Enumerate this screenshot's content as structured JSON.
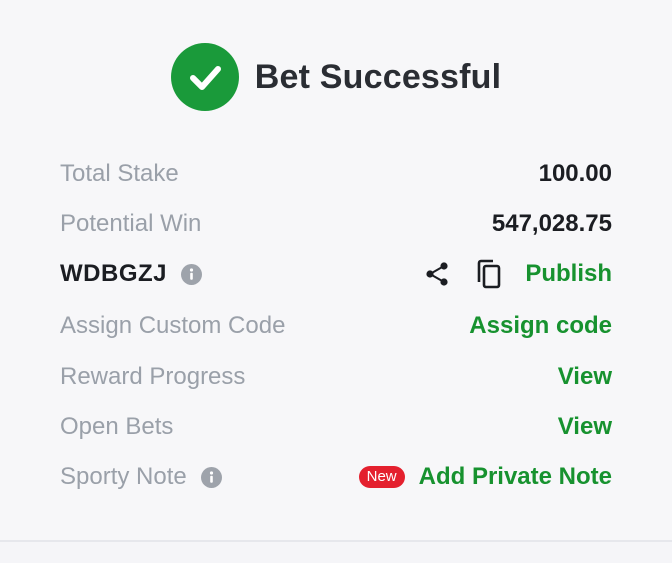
{
  "header": {
    "title": "Bet Successful"
  },
  "rows": {
    "total_stake": {
      "label": "Total Stake",
      "value": "100.00"
    },
    "potential_win": {
      "label": "Potential Win",
      "value": "547,028.75"
    },
    "booking": {
      "code": "WDBGZJ",
      "publish_label": "Publish"
    },
    "custom_code": {
      "label": "Assign Custom Code",
      "action": "Assign code"
    },
    "reward_progress": {
      "label": "Reward Progress",
      "action": "View"
    },
    "open_bets": {
      "label": "Open Bets",
      "action": "View"
    },
    "sporty_note": {
      "label": "Sporty Note",
      "badge": "New",
      "action": "Add Private Note"
    }
  },
  "colors": {
    "accent_green": "#17922f",
    "badge_red": "#e4202e"
  },
  "icons": [
    "check-circle-icon",
    "info-icon",
    "share-icon",
    "copy-icon"
  ]
}
